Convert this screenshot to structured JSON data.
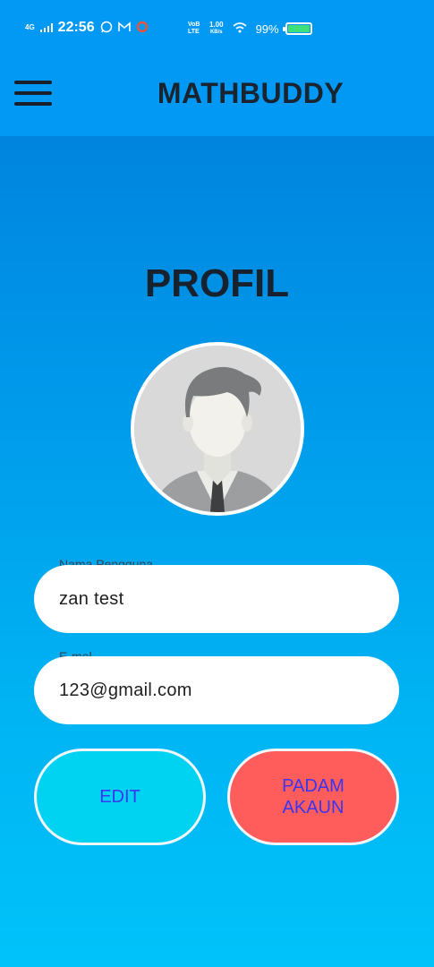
{
  "status_bar": {
    "network": "4G",
    "time": "22:56",
    "volte": "VoB LTE",
    "speed": "1.00",
    "speed_unit": "KB/s",
    "battery_percent": "99%",
    "colors": {
      "battery": "#3ee07a"
    }
  },
  "app_bar": {
    "title": "MATHBUDDY",
    "menu_icon": "hamburger-menu-icon"
  },
  "page": {
    "title": "PROFIL",
    "avatar_icon": "user-avatar-icon"
  },
  "form": {
    "username_label": "Nama Pengguna",
    "username_value": "zan test",
    "email_label": "E-mel",
    "email_value": "123@gmail.com"
  },
  "actions": {
    "edit_label": "EDIT",
    "delete_label_line1": "PADAM",
    "delete_label_line2": "AKAUN"
  },
  "colors": {
    "app_bar": "#0299f4",
    "edit_button": "#00d3f2",
    "delete_button": "#ff5c5c",
    "button_text": "#3a36f2"
  }
}
